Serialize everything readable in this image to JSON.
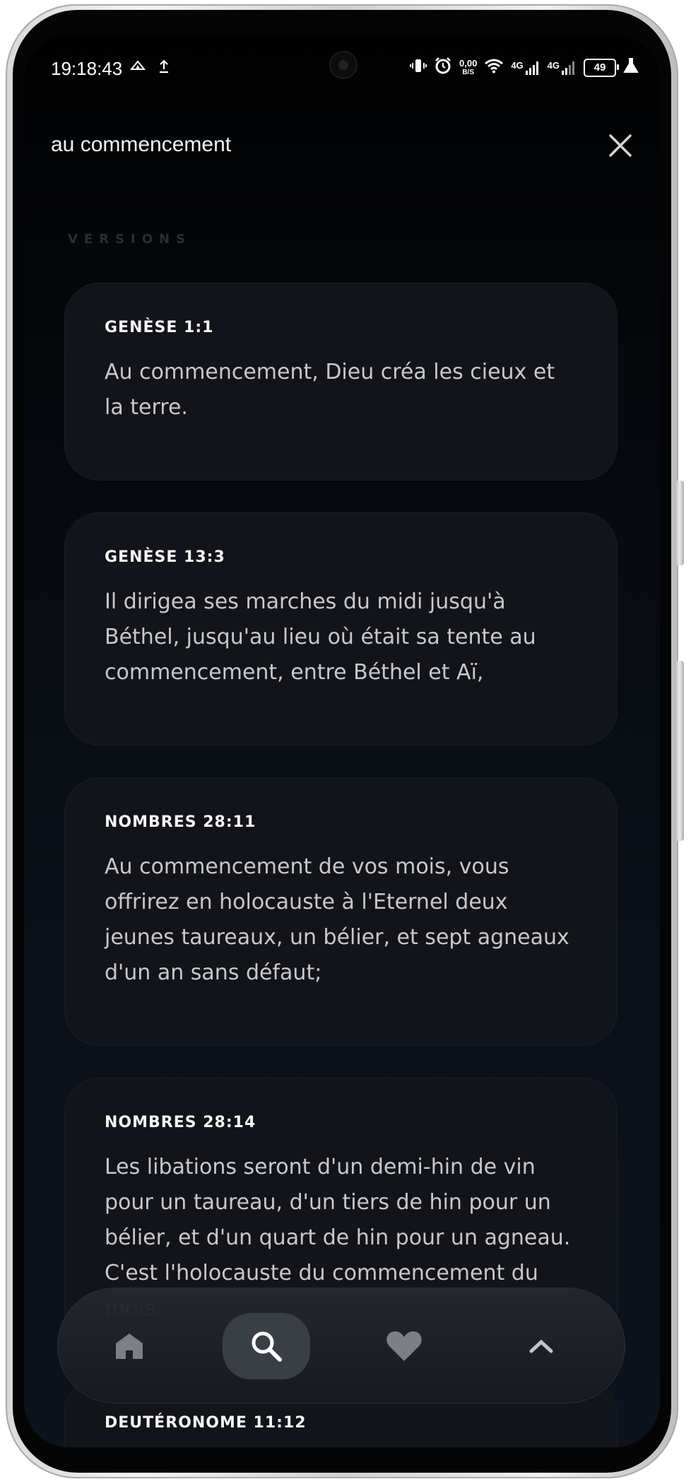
{
  "status_bar": {
    "time": "19:18:43",
    "net_speed_top": "0,00",
    "net_speed_bottom": "B/S",
    "signal1": "4G",
    "signal2": "4G",
    "battery": "49"
  },
  "search": {
    "query": "au commencement",
    "close_icon": "close-icon"
  },
  "section_label": "VERSIONS",
  "results": [
    {
      "reference": "GENÈSE 1:1",
      "text": "Au commencement, Dieu créa les cieux et la terre."
    },
    {
      "reference": "GENÈSE 13:3",
      "text": "Il dirigea ses marches du midi jusqu'à Béthel, jusqu'au lieu où était sa tente au commencement, entre Béthel et Aï,"
    },
    {
      "reference": "NOMBRES 28:11",
      "text": "Au commencement de vos mois, vous offrirez en holocauste à l'Eternel deux jeunes taureaux, un bélier, et sept agneaux d'un an sans défaut;"
    },
    {
      "reference": "NOMBRES 28:14",
      "text": "Les libations seront d'un demi-hin de vin pour un taureau, d'un tiers de hin pour un bélier, et d'un quart de hin pour un agneau. C'est l'holocauste du commencement du mois"
    },
    {
      "reference": "DEUTÉRONOME 11:12",
      "text": ""
    }
  ],
  "nav": {
    "items": [
      {
        "icon": "home-icon"
      },
      {
        "icon": "search-icon"
      },
      {
        "icon": "heart-icon"
      },
      {
        "icon": "chevron-up-icon"
      }
    ],
    "active": "search-icon"
  },
  "colors": {
    "background": "#05070b",
    "card": "#121419",
    "active_nav": "#3a3e45"
  }
}
